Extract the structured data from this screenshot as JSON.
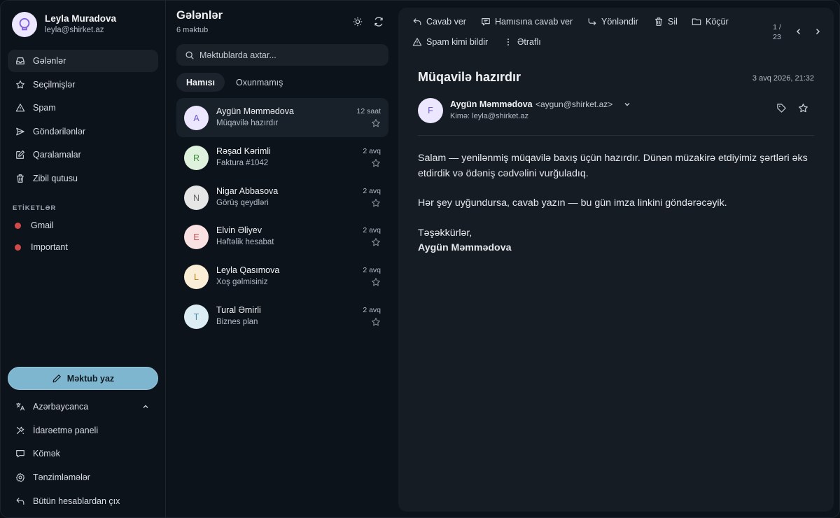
{
  "account": {
    "name": "Leyla Muradova",
    "email": "leyla@shirket.az"
  },
  "sidebar": {
    "items": [
      {
        "label": "Gələnlər",
        "icon": "inbox-icon",
        "active": true
      },
      {
        "label": "Seçilmişlər",
        "icon": "star-icon"
      },
      {
        "label": "Spam",
        "icon": "warning-icon"
      },
      {
        "label": "Göndərilənlər",
        "icon": "send-icon"
      },
      {
        "label": "Qaralamalar",
        "icon": "pencil-icon"
      },
      {
        "label": "Zibil qutusu",
        "icon": "trash-icon"
      }
    ],
    "labels_title": "ETİKETLƏR",
    "labels": [
      {
        "label": "Gmail",
        "color": "#d04a4a"
      },
      {
        "label": "Important",
        "color": "#d04a4a"
      }
    ],
    "compose_label": "Məktub yaz",
    "bottom": [
      {
        "label": "Azərbaycanca",
        "icon": "language-icon"
      },
      {
        "label": "İdarəetmə paneli",
        "icon": "tools-icon"
      },
      {
        "label": "Kömək",
        "icon": "help-icon"
      },
      {
        "label": "Tənzimləmələr",
        "icon": "settings-icon"
      },
      {
        "label": "Bütün hesablardan çıx",
        "icon": "logout-icon"
      }
    ]
  },
  "list": {
    "title": "Gələnlər",
    "count": "6 məktub",
    "search_placeholder": "Məktublarda axtar...",
    "tabs": [
      "Hamısı",
      "Oxunmamış"
    ],
    "mails": [
      {
        "initial": "A",
        "from": "Aygün Məmmədova",
        "subject": "Müqavilə hazırdır",
        "time": "12 saat",
        "bg": "#ece7ff",
        "fg": "#6a5acd",
        "active": true
      },
      {
        "initial": "R",
        "from": "Rəşad Kərimli",
        "subject": "Faktura #1042",
        "time": "2 avq",
        "bg": "#dff2dd",
        "fg": "#3f8a3a"
      },
      {
        "initial": "N",
        "from": "Nigar Abbasova",
        "subject": "Görüş qeydləri",
        "time": "2 avq",
        "bg": "#e6e6e6",
        "fg": "#666666"
      },
      {
        "initial": "E",
        "from": "Elvin Əliyev",
        "subject": "Həftəlik hesabat",
        "time": "2 avq",
        "bg": "#fbe2e2",
        "fg": "#c0504d"
      },
      {
        "initial": "L",
        "from": "Leyla Qasımova",
        "subject": "Xoş gəlmisiniz",
        "time": "2 avq",
        "bg": "#fbeed6",
        "fg": "#b07a1d"
      },
      {
        "initial": "T",
        "from": "Tural Əmirli",
        "subject": "Biznes plan",
        "time": "2 avq",
        "bg": "#dceef4",
        "fg": "#4a8aa0"
      }
    ]
  },
  "reader": {
    "toolbar": {
      "reply": "Cavab ver",
      "reply_all": "Hamısına cavab ver",
      "forward": "Yönləndir",
      "delete": "Sil",
      "move": "Köçür",
      "spam": "Spam kimi bildir",
      "more": "Ətraflı"
    },
    "pager_current": "1 /",
    "pager_total": "23",
    "subject": "Müqavilə hazırdır",
    "date": "3 avq 2026, 21:32",
    "sender_initial": "F",
    "sender_name": "Aygün Məmmədova",
    "sender_email": "<aygun@shirket.az>",
    "to": "Kimə: leyla@shirket.az",
    "body": [
      "Salam — yenilənmiş müqavilə baxış üçün hazırdır. Dünən müzakirə etdiyimiz şərtləri əks etdirdik və ödəniş cədvəlini vurğuladıq.",
      "Hər şey uyğundursa, cavab yazın — bu gün imza linkini göndərəcəyik.",
      "Təşəkkürlər,"
    ],
    "signature": "Aygün Məmmədova"
  }
}
